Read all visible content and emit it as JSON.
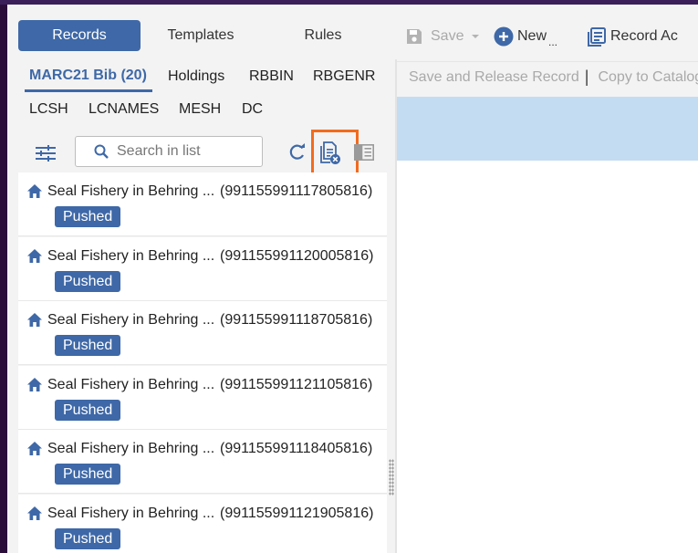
{
  "mode_tabs": {
    "records": "Records",
    "templates": "Templates",
    "rules": "Rules"
  },
  "toolbar": {
    "save_label": "Save",
    "new_label": "New",
    "new_suffix": "...",
    "record_actions_label": "Record Ac"
  },
  "actionbar": {
    "save_release": "Save and Release Record",
    "separator": "|",
    "copy_to_catalog": "Copy to Catalog"
  },
  "profile_tabs": {
    "marc21_bib": "MARC21 Bib (20)",
    "holdings": "Holdings",
    "rbbin": "RBBIN",
    "rbgenr": "RBGENR",
    "lcsh": "LCSH",
    "lcnames": "LCNAMES",
    "mesh": "MESH",
    "dc": "DC"
  },
  "search": {
    "placeholder": "Search in list"
  },
  "records": [
    {
      "title": "Seal Fishery in Behring ...",
      "mms_id": "(991155991117805816)",
      "status": "Pushed"
    },
    {
      "title": "Seal Fishery in Behring ...",
      "mms_id": "(991155991120005816)",
      "status": "Pushed"
    },
    {
      "title": "Seal Fishery in Behring ...",
      "mms_id": "(991155991118705816)",
      "status": "Pushed"
    },
    {
      "title": "Seal Fishery in Behring ...",
      "mms_id": "(991155991121105816)",
      "status": "Pushed"
    },
    {
      "title": "Seal Fishery in Behring ...",
      "mms_id": "(991155991118405816)",
      "status": "Pushed"
    },
    {
      "title": "Seal Fishery in Behring ...",
      "mms_id": "(991155991121905816)",
      "status": "Pushed"
    }
  ],
  "colors": {
    "primary": "#3e68a7",
    "highlight": "#f26b1d",
    "selection_band": "#c3dcf2",
    "disabled_text": "#a9a9a9"
  },
  "icons": {
    "filter": "sliders-icon",
    "search": "search-icon",
    "refresh": "refresh-icon",
    "clear_list": "clear-list-icon",
    "panel": "panel-toggle-icon",
    "home": "home-icon",
    "save": "floppy-disk-icon",
    "new": "plus-circle-icon",
    "record_actions": "record-actions-icon"
  }
}
